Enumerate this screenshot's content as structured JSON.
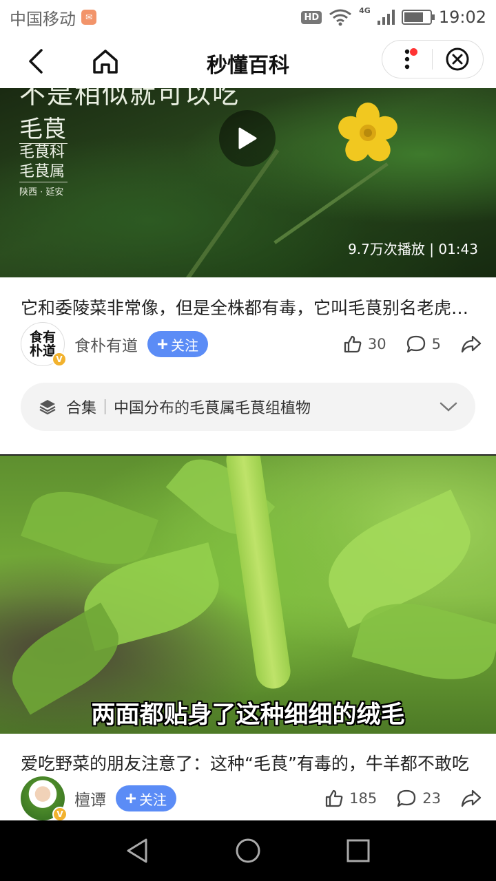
{
  "status_bar": {
    "carrier": "中国移动",
    "network": "4G",
    "hd": "HD",
    "battery_level": 0.75,
    "time": "19:02"
  },
  "nav": {
    "title": "秒懂百科",
    "icons": [
      "back-icon",
      "home-icon",
      "more-icon",
      "close-circle-icon"
    ]
  },
  "video1": {
    "top_text": "不是相似就可以吃",
    "plant_name": "毛茛",
    "family": "毛茛科",
    "genus": "毛茛属",
    "location": "陕西 · 延安",
    "views": "9.7万次播放",
    "duration": "01:43"
  },
  "card1": {
    "title": "它和委陵菜非常像，但是全株都有毒，它叫毛茛别名老虎脚迹草",
    "author": "食朴有道",
    "avatar_text": "食有朴道",
    "follow": "关注",
    "likes": "30",
    "comments": "5"
  },
  "collection": {
    "label": "合集",
    "name": "中国分布的毛茛属毛茛组植物"
  },
  "video2": {
    "subtitle": "两面都贴身了这种细细的绒毛"
  },
  "card2": {
    "title": "爱吃野菜的朋友注意了：这种“毛茛”有毒的，牛羊都不敢吃",
    "author": "檀谭",
    "follow": "关注",
    "likes": "185",
    "comments": "23"
  },
  "colors": {
    "follow_bg": "#5b8cf6",
    "badge": "#f2b22e",
    "notification_dot": "#ff3333"
  }
}
